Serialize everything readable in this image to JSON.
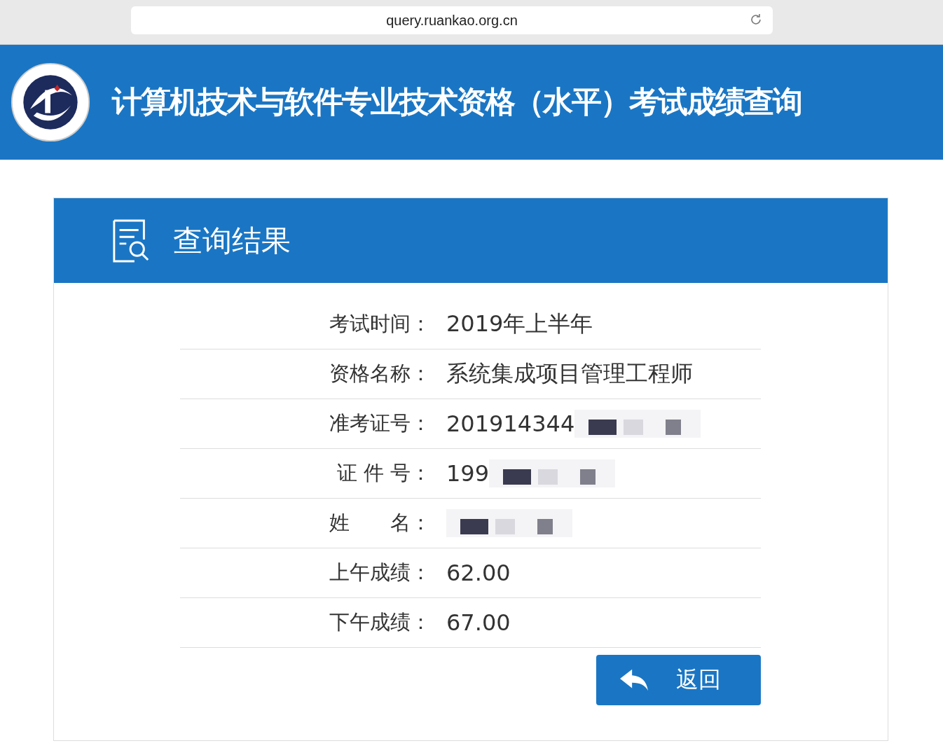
{
  "browser": {
    "url": "query.ruankao.org.cn"
  },
  "header": {
    "title": "计算机技术与软件专业技术资格（水平）考试成绩查询"
  },
  "card": {
    "title": "查询结果"
  },
  "rows": [
    {
      "label": "考试时间：",
      "value": "2019年上半年",
      "redacted": false
    },
    {
      "label": "资格名称：",
      "value": "系统集成项目管理工程师",
      "redacted": false
    },
    {
      "label": "准考证号：",
      "value": "201914344",
      "redacted": true
    },
    {
      "label": "证 件 号：",
      "value": "199",
      "redacted": true
    },
    {
      "label": "姓　　名：",
      "redacted": true
    },
    {
      "label": "上午成绩：",
      "value": "62.00",
      "redacted": false
    },
    {
      "label": "下午成绩：",
      "value": "67.00",
      "redacted": false
    }
  ],
  "back_button": {
    "label": "返回"
  }
}
